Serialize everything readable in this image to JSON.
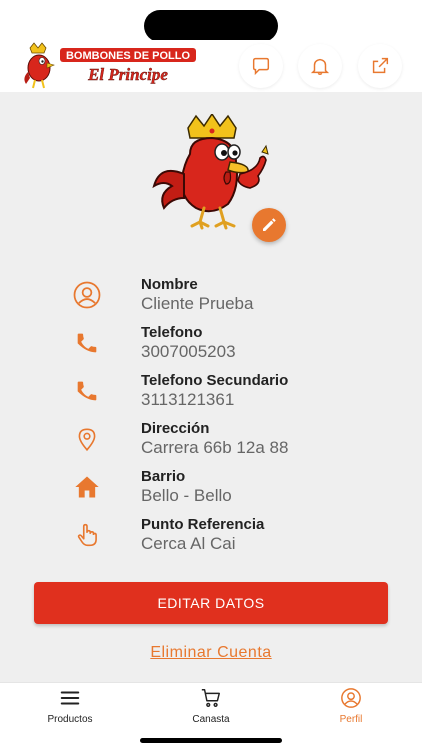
{
  "brand": {
    "line1": "BOMBONES DE POLLO",
    "line2": "El Principe",
    "accent_color": "#e8782f",
    "primary_color": "#e0301e"
  },
  "header": {
    "actions": [
      {
        "icon": "chat-bubble-icon"
      },
      {
        "icon": "bell-icon"
      },
      {
        "icon": "share-external-icon"
      }
    ]
  },
  "profile": {
    "avatar_icon": "rooster-mascot",
    "edit_icon": "pencil-icon",
    "fields": [
      {
        "label": "Nombre",
        "value": "Cliente Prueba",
        "icon": "user-circle-icon"
      },
      {
        "label": "Telefono",
        "value": "3007005203",
        "icon": "phone-icon"
      },
      {
        "label": "Telefono Secundario",
        "value": "3113121361",
        "icon": "phone-icon"
      },
      {
        "label": "Dirección",
        "value": "Carrera 66b 12a 88",
        "icon": "map-pin-icon"
      },
      {
        "label": "Barrio",
        "value": "Bello - Bello",
        "icon": "home-icon"
      },
      {
        "label": "Punto Referencia",
        "value": "Cerca Al Cai",
        "icon": "pointing-hand-icon"
      }
    ],
    "edit_button": "EDITAR DATOS",
    "delete_link": "Eliminar Cuenta"
  },
  "bottom_nav": {
    "items": [
      {
        "label": "Productos",
        "icon": "menu-icon",
        "active": false
      },
      {
        "label": "Canasta",
        "icon": "cart-icon",
        "active": false
      },
      {
        "label": "Perfil",
        "icon": "user-circle-icon",
        "active": true
      }
    ]
  }
}
